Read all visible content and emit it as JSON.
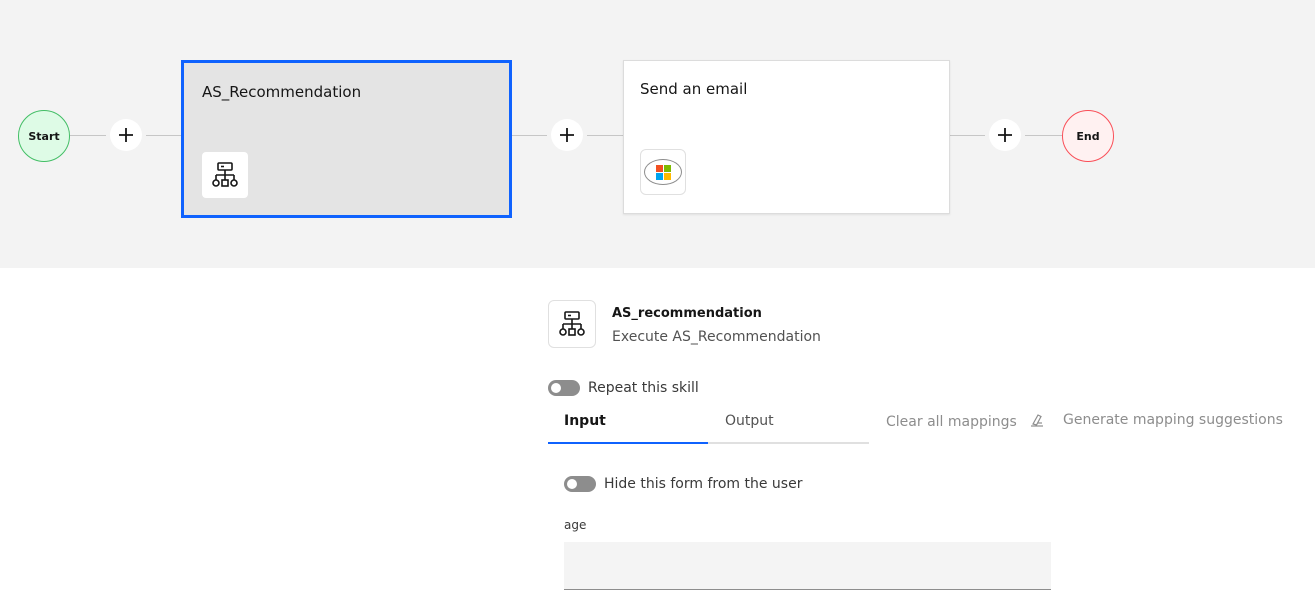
{
  "flow": {
    "start_label": "Start",
    "end_label": "End",
    "nodes": [
      {
        "title": "AS_Recommendation",
        "icon": "hierarchy-icon",
        "selected": true
      },
      {
        "title": "Send an email",
        "icon": "microsoft-logo-icon",
        "selected": false
      }
    ],
    "add_icon": "plus-icon"
  },
  "details": {
    "skill_name": "AS_recommendation",
    "skill_description": "Execute AS_Recommendation",
    "repeat_label": "Repeat this skill",
    "tabs": [
      {
        "label": "Input",
        "active": true
      },
      {
        "label": "Output",
        "active": false
      }
    ],
    "clear_mappings_label": "Clear all mappings",
    "generate_label": "Generate mapping suggestions",
    "hide_form_label": "Hide this form from the user",
    "fields": [
      {
        "label": "age",
        "value": ""
      }
    ]
  },
  "colors": {
    "accent": "#0f62fe",
    "start_fill": "#defbe6",
    "start_border": "#42be65",
    "end_fill": "#fff1f1",
    "end_border": "#fa4d56"
  }
}
